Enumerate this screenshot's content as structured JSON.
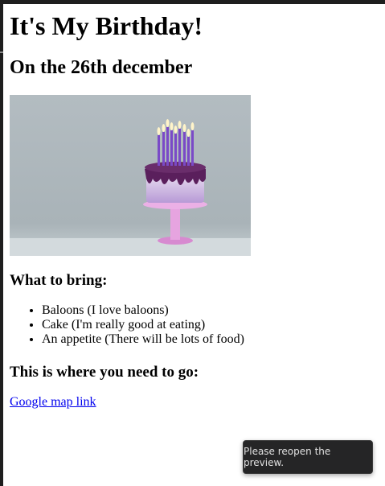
{
  "page": {
    "title": "It's My Birthday!",
    "subtitle": "On the 26th december"
  },
  "image": {
    "subject": "birthday-cake",
    "colors": {
      "background": "#aeb7bc",
      "frosting": "#d8c6e8",
      "drip": "#5a1f5c",
      "stand": "#e29ad9",
      "candles": "#7a4ac7"
    }
  },
  "bring": {
    "heading": "What to bring:",
    "items": [
      "Baloons (I love baloons)",
      "Cake (I'm really good at eating)",
      "An appetite (There will be lots of food)"
    ]
  },
  "location": {
    "heading": "This is where you need to go:",
    "link_text": "Google map link"
  },
  "notification": {
    "message": "Please reopen the preview."
  }
}
